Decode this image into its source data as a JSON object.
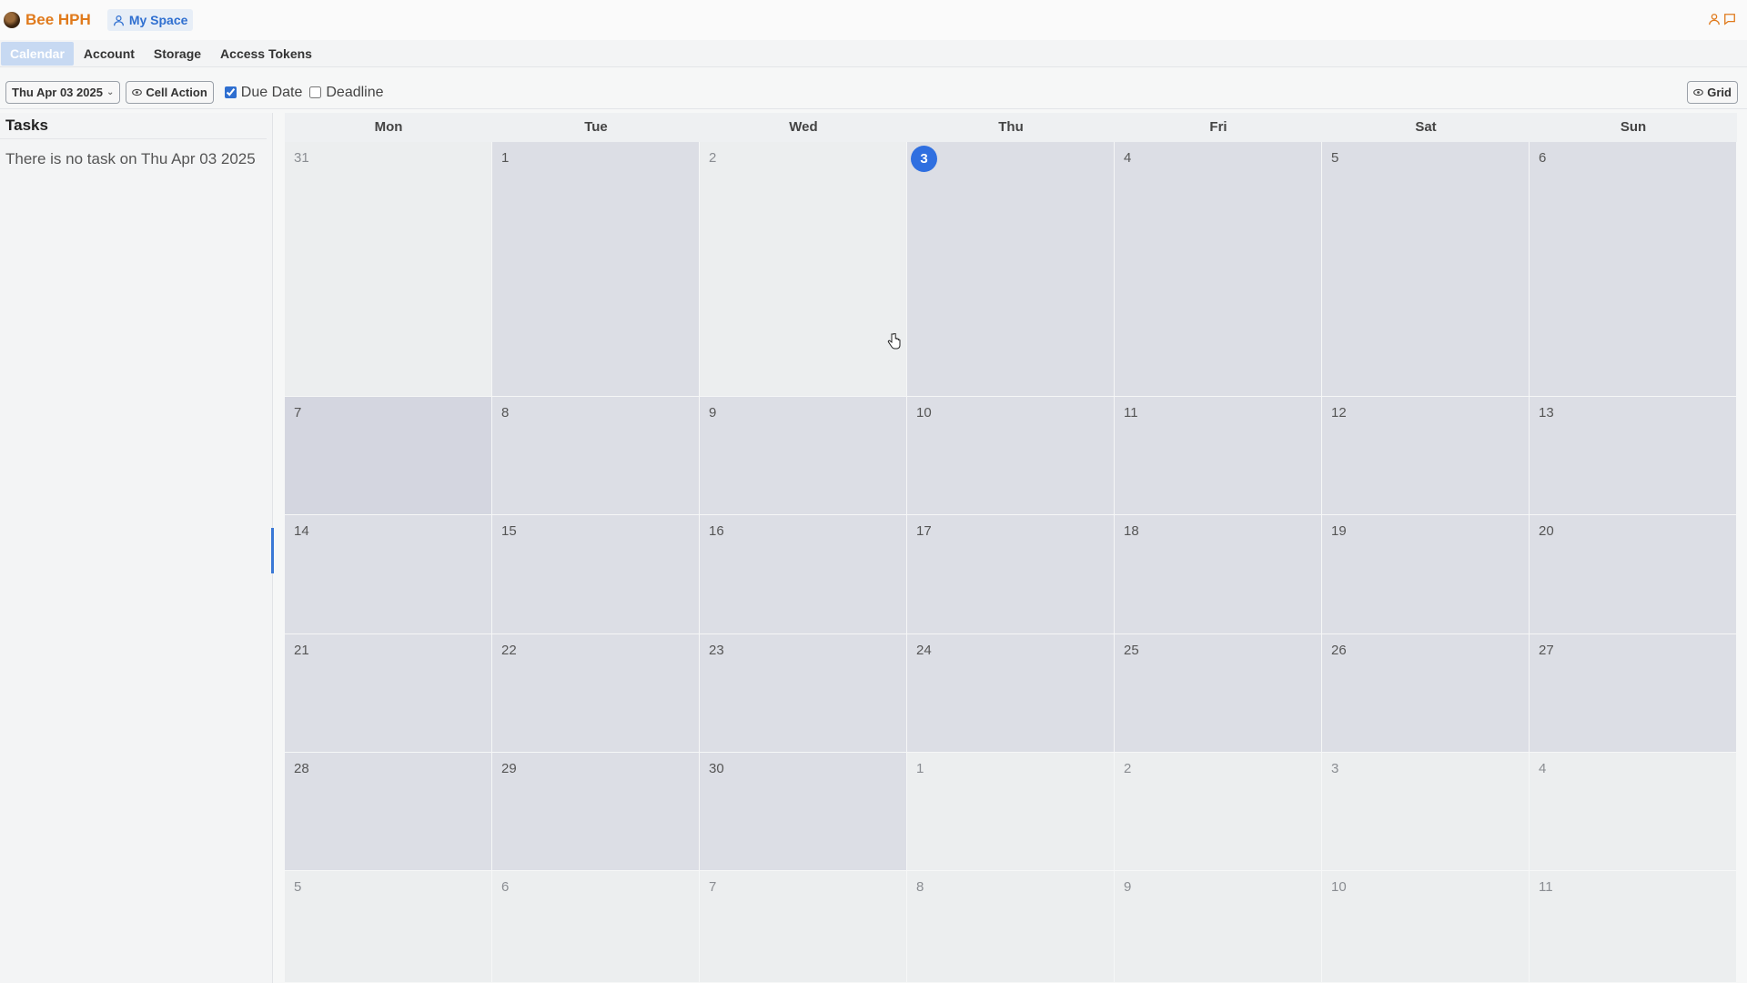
{
  "app": {
    "brand": "Bee HPH",
    "space": "My Space"
  },
  "nav": {
    "tabs": [
      {
        "label": "Calendar"
      },
      {
        "label": "Account"
      },
      {
        "label": "Storage"
      },
      {
        "label": "Access Tokens"
      }
    ]
  },
  "toolbar": {
    "date_select": "Thu Apr 03 2025",
    "cell_action": "Cell Action",
    "due_date": "Due Date",
    "deadline": "Deadline",
    "grid": "Grid",
    "due_date_checked": true,
    "deadline_checked": false
  },
  "tasks": {
    "title": "Tasks",
    "empty_message": "There is no task on Thu Apr 03 2025"
  },
  "calendar": {
    "weekdays": [
      "Mon",
      "Tue",
      "Wed",
      "Thu",
      "Fri",
      "Sat",
      "Sun"
    ],
    "weeks": [
      [
        "31",
        "1",
        "2",
        "3",
        "4",
        "5",
        "6"
      ],
      [
        "7",
        "8",
        "9",
        "10",
        "11",
        "12",
        "13"
      ],
      [
        "14",
        "15",
        "16",
        "17",
        "18",
        "19",
        "20"
      ],
      [
        "21",
        "22",
        "23",
        "24",
        "25",
        "26",
        "27"
      ],
      [
        "28",
        "29",
        "30",
        "1",
        "2",
        "3",
        "4"
      ],
      [
        "5",
        "6",
        "7",
        "8",
        "9",
        "10",
        "11"
      ]
    ],
    "today": "3"
  },
  "colors": {
    "accent": "#2f6fe0",
    "brand": "#e07a1c",
    "current_month_cell": "#dcdee5",
    "other_month_cell": "#eceeef"
  }
}
